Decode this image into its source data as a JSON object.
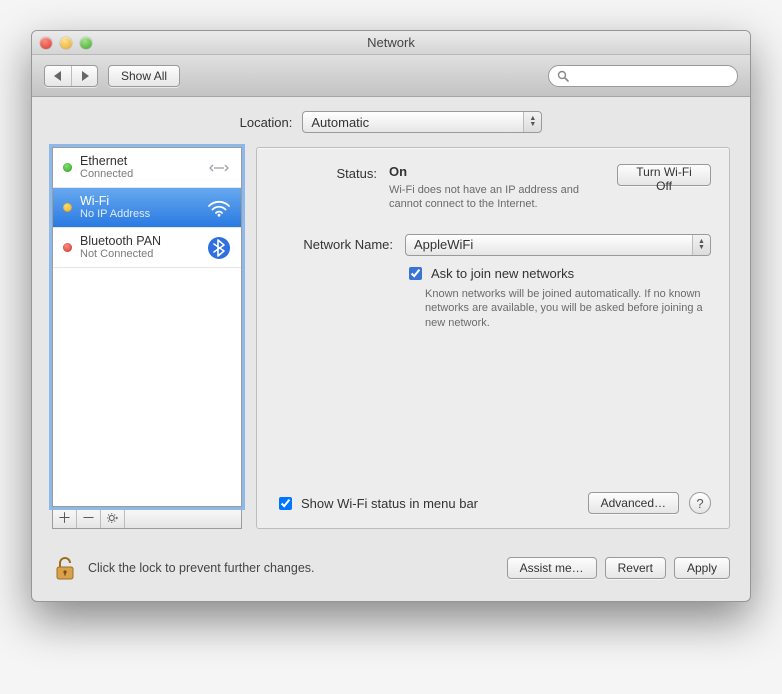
{
  "window": {
    "title": "Network"
  },
  "toolbar": {
    "showAll": "Show All",
    "searchPlaceholder": ""
  },
  "location": {
    "label": "Location:",
    "value": "Automatic"
  },
  "sidebar": {
    "services": [
      {
        "name": "Ethernet",
        "status": "Connected",
        "dot": "green",
        "icon": "ethernet-icon"
      },
      {
        "name": "Wi-Fi",
        "status": "No IP Address",
        "dot": "yellow",
        "icon": "wifi-icon",
        "selected": true
      },
      {
        "name": "Bluetooth PAN",
        "status": "Not Connected",
        "dot": "red",
        "icon": "bluetooth-icon"
      }
    ]
  },
  "detail": {
    "statusLabel": "Status:",
    "statusValue": "On",
    "statusHint": "Wi-Fi does not have an IP address and cannot connect to the Internet.",
    "turnOffBtn": "Turn Wi-Fi Off",
    "networkNameLabel": "Network Name:",
    "networkNameValue": "AppleWiFi",
    "askJoinLabel": "Ask to join new networks",
    "askJoinHint": "Known networks will be joined automatically. If no known networks are available, you will be asked before joining a new network.",
    "menubarLabel": "Show Wi-Fi status in menu bar",
    "advancedBtn": "Advanced…",
    "helpBtn": "?"
  },
  "bottom": {
    "lockMsg": "Click the lock to prevent further changes.",
    "assist": "Assist me…",
    "revert": "Revert",
    "apply": "Apply"
  }
}
